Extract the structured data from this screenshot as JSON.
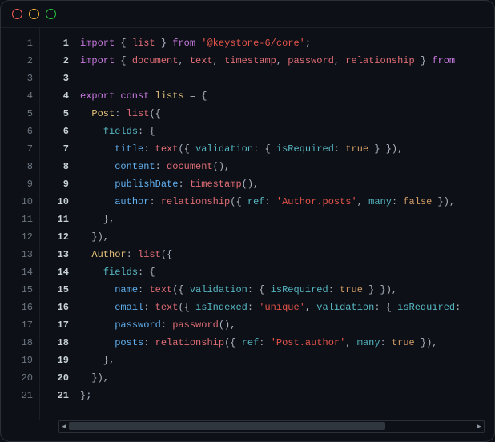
{
  "window": {
    "traffic_lights": [
      "red",
      "yellow",
      "green"
    ]
  },
  "gutter_outer": [
    "1",
    "2",
    "3",
    "4",
    "5",
    "6",
    "7",
    "8",
    "9",
    "10",
    "11",
    "12",
    "13",
    "14",
    "15",
    "16",
    "17",
    "18",
    "19",
    "20",
    "21"
  ],
  "gutter_inner": [
    "1",
    "2",
    "3",
    "4",
    "5",
    "6",
    "7",
    "8",
    "9",
    "10",
    "11",
    "12",
    "13",
    "14",
    "15",
    "16",
    "17",
    "18",
    "19",
    "20",
    "21"
  ],
  "code_lines": [
    [
      [
        "kw",
        "import"
      ],
      [
        "p",
        " { "
      ],
      [
        "id",
        "list"
      ],
      [
        "p",
        " } "
      ],
      [
        "kw",
        "from"
      ],
      [
        "p",
        " "
      ],
      [
        "str",
        "'@keystone-6/core'"
      ],
      [
        "p",
        ";"
      ]
    ],
    [
      [
        "kw",
        "import"
      ],
      [
        "p",
        " { "
      ],
      [
        "id",
        "document"
      ],
      [
        "p",
        ", "
      ],
      [
        "id",
        "text"
      ],
      [
        "p",
        ", "
      ],
      [
        "id",
        "timestamp"
      ],
      [
        "p",
        ", "
      ],
      [
        "id",
        "password"
      ],
      [
        "p",
        ", "
      ],
      [
        "id",
        "relationship"
      ],
      [
        "p",
        " } "
      ],
      [
        "kw",
        "from"
      ]
    ],
    [],
    [
      [
        "kw",
        "export const"
      ],
      [
        "p",
        " "
      ],
      [
        "var",
        "lists"
      ],
      [
        "p",
        " = {"
      ]
    ],
    [
      [
        "p",
        "  "
      ],
      [
        "var",
        "Post"
      ],
      [
        "p",
        ": "
      ],
      [
        "id",
        "list"
      ],
      [
        "p",
        "({"
      ]
    ],
    [
      [
        "p",
        "    "
      ],
      [
        "key",
        "fields"
      ],
      [
        "p",
        ": {"
      ]
    ],
    [
      [
        "p",
        "      "
      ],
      [
        "key2",
        "title"
      ],
      [
        "p",
        ": "
      ],
      [
        "id",
        "text"
      ],
      [
        "p",
        "({ "
      ],
      [
        "key",
        "validation"
      ],
      [
        "p",
        ": { "
      ],
      [
        "key",
        "isRequired"
      ],
      [
        "p",
        ": "
      ],
      [
        "bool",
        "true"
      ],
      [
        "p",
        " } }),"
      ]
    ],
    [
      [
        "p",
        "      "
      ],
      [
        "key2",
        "content"
      ],
      [
        "p",
        ": "
      ],
      [
        "id",
        "document"
      ],
      [
        "p",
        "(),"
      ]
    ],
    [
      [
        "p",
        "      "
      ],
      [
        "key2",
        "publishDate"
      ],
      [
        "p",
        ": "
      ],
      [
        "id",
        "timestamp"
      ],
      [
        "p",
        "(),"
      ]
    ],
    [
      [
        "p",
        "      "
      ],
      [
        "key2",
        "author"
      ],
      [
        "p",
        ": "
      ],
      [
        "id",
        "relationship"
      ],
      [
        "p",
        "({ "
      ],
      [
        "key",
        "ref"
      ],
      [
        "p",
        ": "
      ],
      [
        "str",
        "'Author.posts'"
      ],
      [
        "p",
        ", "
      ],
      [
        "key",
        "many"
      ],
      [
        "p",
        ": "
      ],
      [
        "bool",
        "false"
      ],
      [
        "p",
        " }),"
      ]
    ],
    [
      [
        "p",
        "    },"
      ]
    ],
    [
      [
        "p",
        "  }),"
      ]
    ],
    [
      [
        "p",
        "  "
      ],
      [
        "var",
        "Author"
      ],
      [
        "p",
        ": "
      ],
      [
        "id",
        "list"
      ],
      [
        "p",
        "({"
      ]
    ],
    [
      [
        "p",
        "    "
      ],
      [
        "key",
        "fields"
      ],
      [
        "p",
        ": {"
      ]
    ],
    [
      [
        "p",
        "      "
      ],
      [
        "key2",
        "name"
      ],
      [
        "p",
        ": "
      ],
      [
        "id",
        "text"
      ],
      [
        "p",
        "({ "
      ],
      [
        "key",
        "validation"
      ],
      [
        "p",
        ": { "
      ],
      [
        "key",
        "isRequired"
      ],
      [
        "p",
        ": "
      ],
      [
        "bool",
        "true"
      ],
      [
        "p",
        " } }),"
      ]
    ],
    [
      [
        "p",
        "      "
      ],
      [
        "key2",
        "email"
      ],
      [
        "p",
        ": "
      ],
      [
        "id",
        "text"
      ],
      [
        "p",
        "({ "
      ],
      [
        "key",
        "isIndexed"
      ],
      [
        "p",
        ": "
      ],
      [
        "str",
        "'unique'"
      ],
      [
        "p",
        ", "
      ],
      [
        "key",
        "validation"
      ],
      [
        "p",
        ": { "
      ],
      [
        "key",
        "isRequired"
      ],
      [
        "p",
        ":"
      ]
    ],
    [
      [
        "p",
        "      "
      ],
      [
        "key2",
        "password"
      ],
      [
        "p",
        ": "
      ],
      [
        "id",
        "password"
      ],
      [
        "p",
        "(),"
      ]
    ],
    [
      [
        "p",
        "      "
      ],
      [
        "key2",
        "posts"
      ],
      [
        "p",
        ": "
      ],
      [
        "id",
        "relationship"
      ],
      [
        "p",
        "({ "
      ],
      [
        "key",
        "ref"
      ],
      [
        "p",
        ": "
      ],
      [
        "str",
        "'Post.author'"
      ],
      [
        "p",
        ", "
      ],
      [
        "key",
        "many"
      ],
      [
        "p",
        ": "
      ],
      [
        "bool",
        "true"
      ],
      [
        "p",
        " }),"
      ]
    ],
    [
      [
        "p",
        "    },"
      ]
    ],
    [
      [
        "p",
        "  }),"
      ]
    ],
    [
      [
        "p",
        "};"
      ]
    ]
  ],
  "scrollbar": {
    "left_arrow": "◀",
    "right_arrow": "▶"
  }
}
